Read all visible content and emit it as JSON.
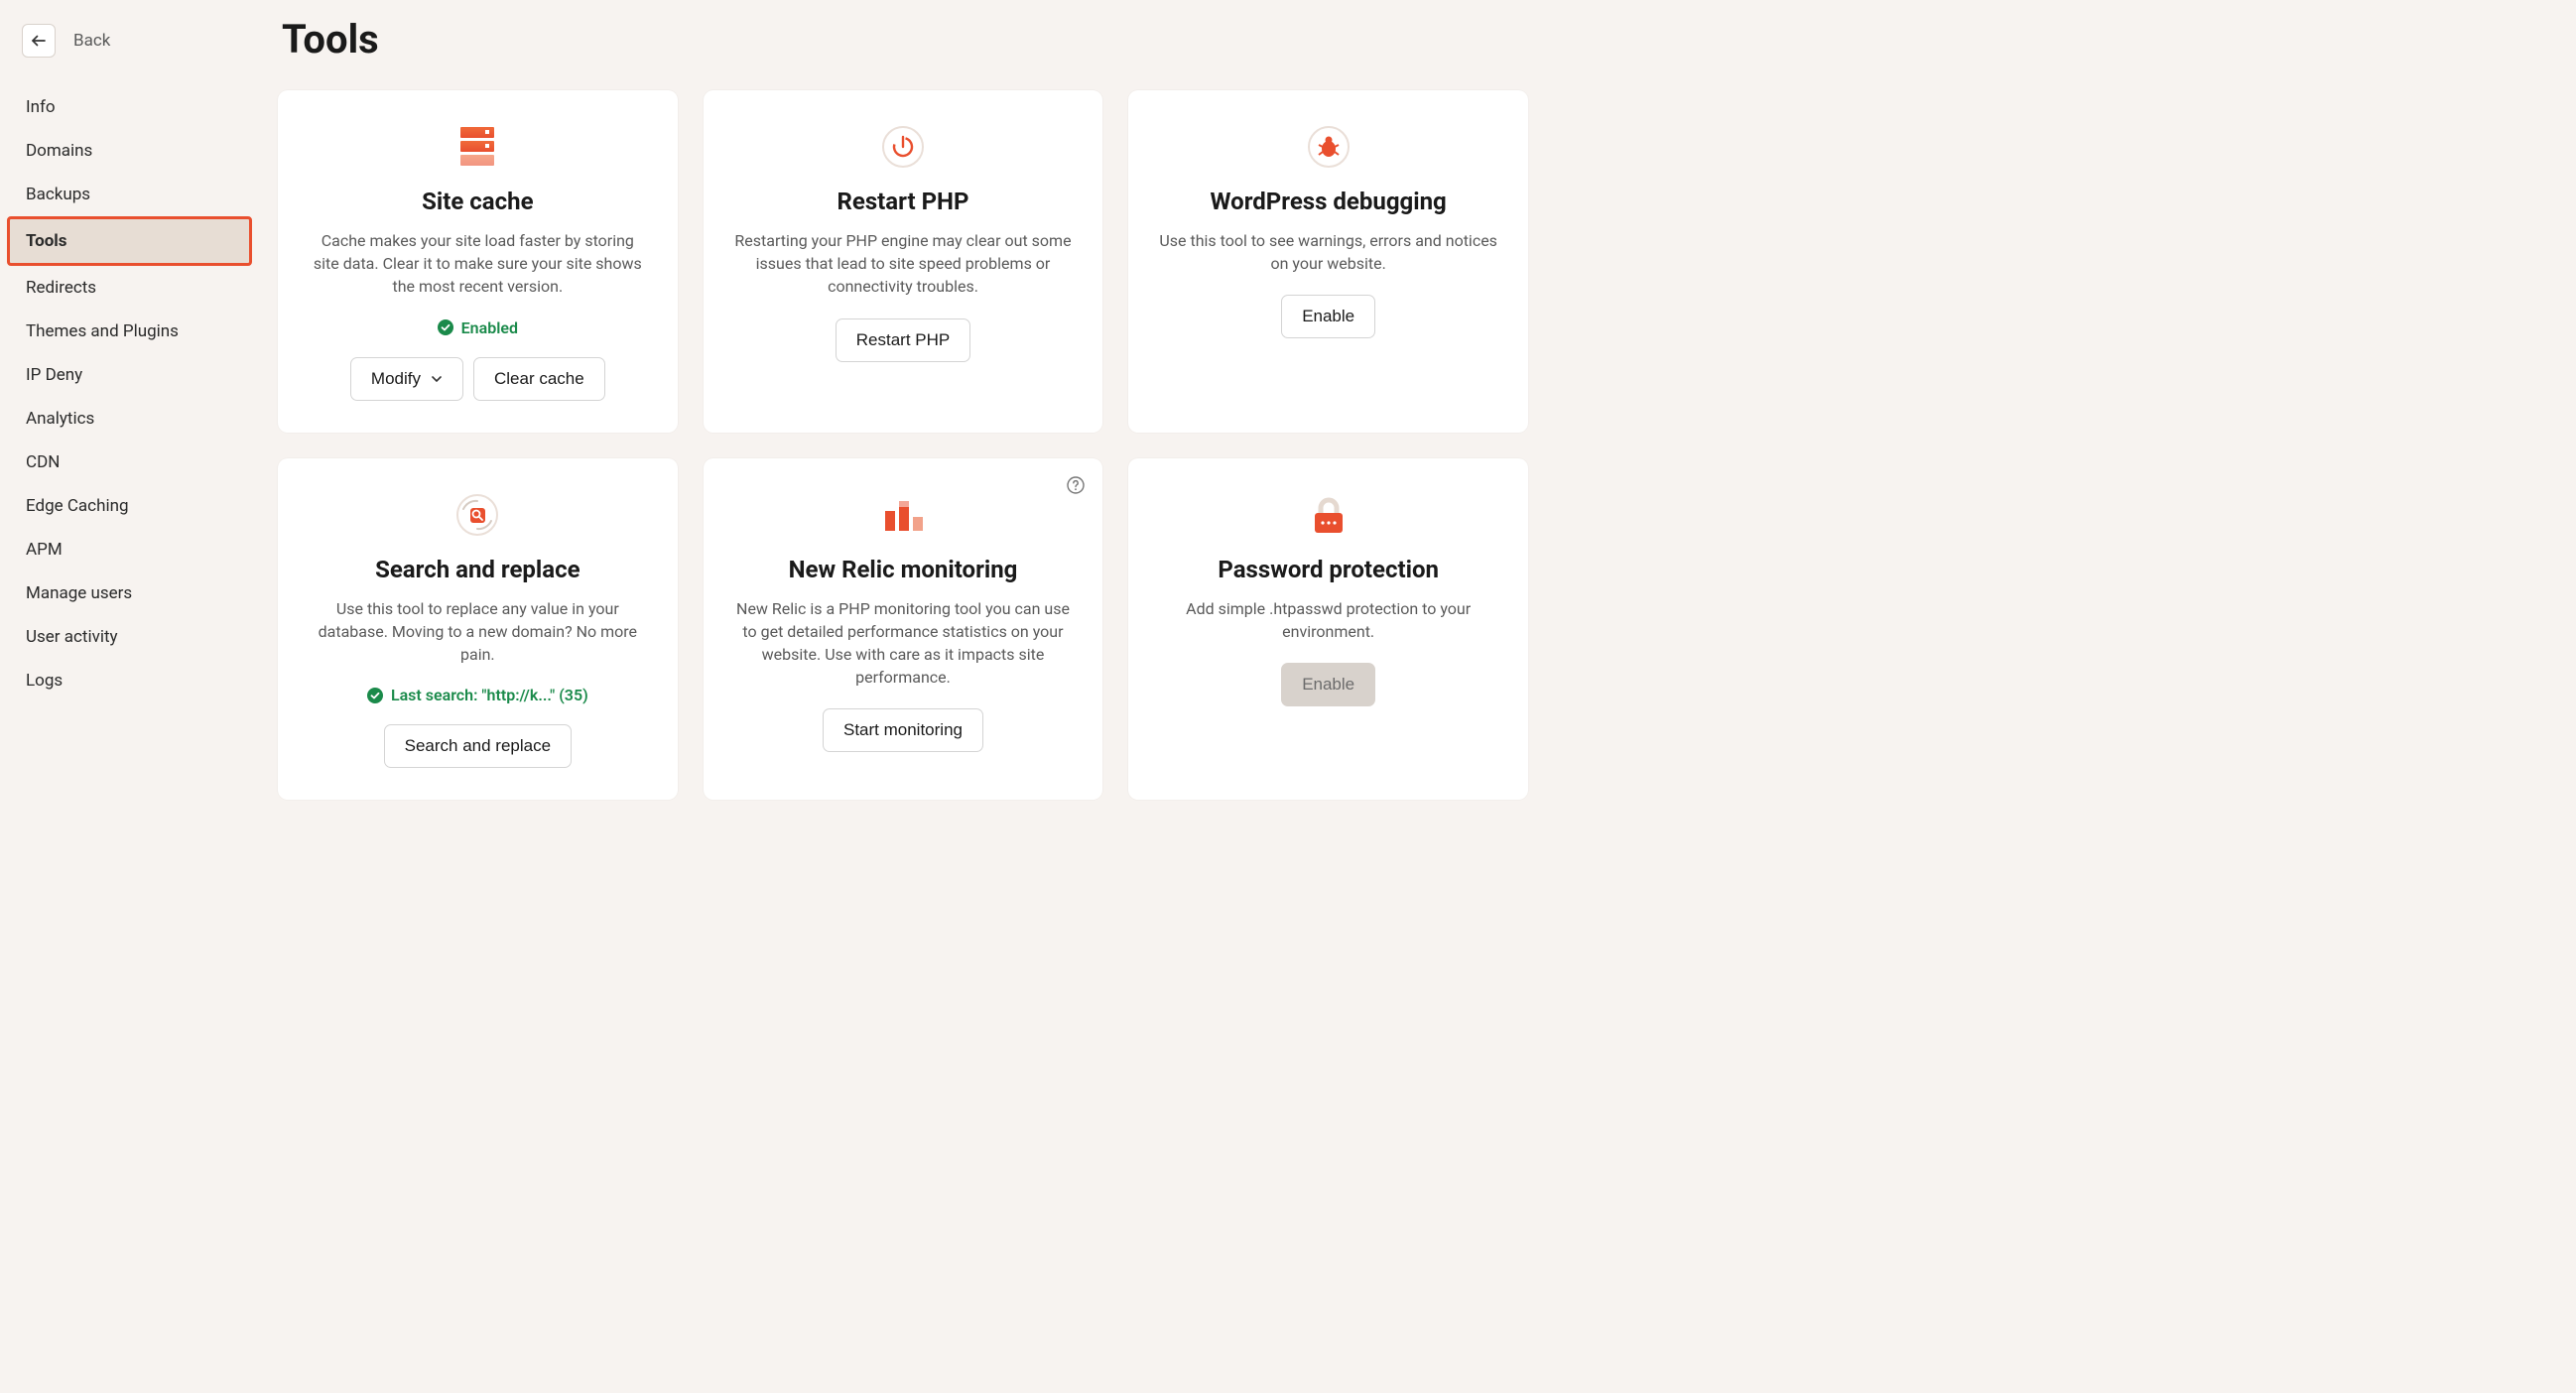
{
  "back": {
    "label": "Back"
  },
  "page_title": "Tools",
  "sidebar": {
    "items": [
      {
        "label": "Info"
      },
      {
        "label": "Domains"
      },
      {
        "label": "Backups"
      },
      {
        "label": "Tools",
        "active": true
      },
      {
        "label": "Redirects"
      },
      {
        "label": "Themes and Plugins"
      },
      {
        "label": "IP Deny"
      },
      {
        "label": "Analytics"
      },
      {
        "label": "CDN"
      },
      {
        "label": "Edge Caching"
      },
      {
        "label": "APM"
      },
      {
        "label": "Manage users"
      },
      {
        "label": "User activity"
      },
      {
        "label": "Logs"
      }
    ]
  },
  "cards": {
    "site_cache": {
      "title": "Site cache",
      "desc": "Cache makes your site load faster by storing site data. Clear it to make sure your site shows the most recent version.",
      "status": "Enabled",
      "modify_label": "Modify",
      "clear_label": "Clear cache"
    },
    "restart_php": {
      "title": "Restart PHP",
      "desc": "Restarting your PHP engine may clear out some issues that lead to site speed problems or connectivity troubles.",
      "button": "Restart PHP"
    },
    "wp_debug": {
      "title": "WordPress debugging",
      "desc": "Use this tool to see warnings, errors and notices on your website.",
      "button": "Enable"
    },
    "search_replace": {
      "title": "Search and replace",
      "desc": "Use this tool to replace any value in your database. Moving to a new domain? No more pain.",
      "status": "Last search: \"http://k...\" (35)",
      "button": "Search and replace"
    },
    "new_relic": {
      "title": "New Relic monitoring",
      "desc": "New Relic is a PHP monitoring tool you can use to get detailed performance statistics on your website. Use with care as it impacts site performance.",
      "button": "Start monitoring"
    },
    "password": {
      "title": "Password protection",
      "desc": "Add simple .htpasswd protection to your environment.",
      "button": "Enable"
    }
  },
  "colors": {
    "accent": "#e94f2e",
    "green": "#1a8a4a"
  }
}
